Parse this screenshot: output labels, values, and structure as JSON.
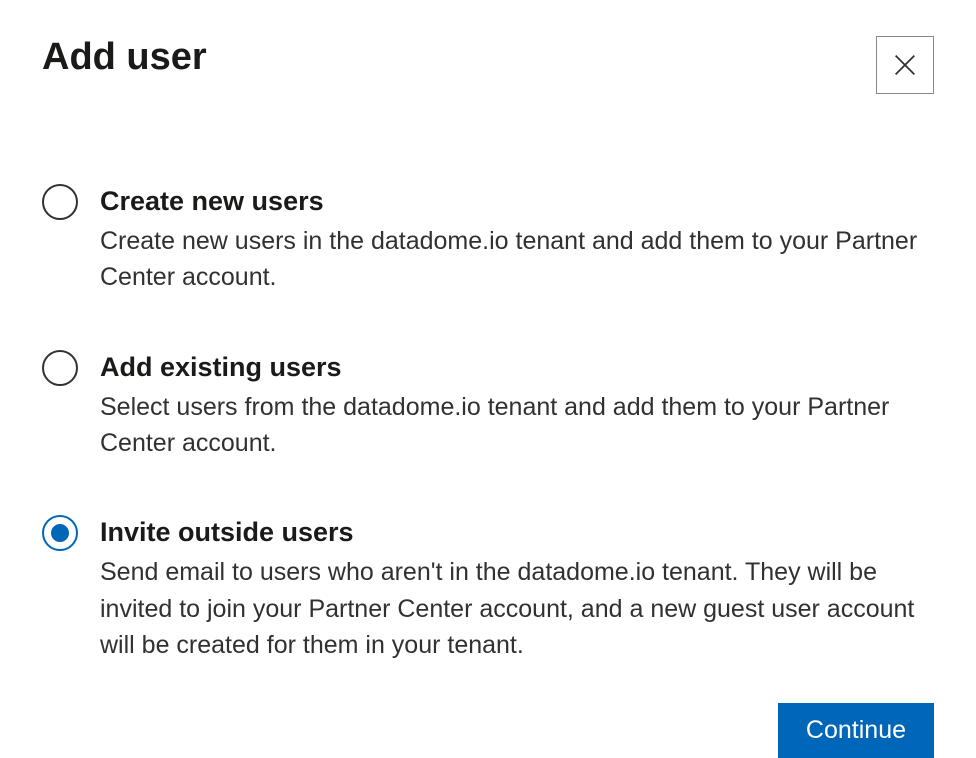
{
  "dialog": {
    "title": "Add user",
    "options": [
      {
        "title": "Create new users",
        "description": "Create new users in the datadome.io tenant and add them to your Partner Center account.",
        "selected": false
      },
      {
        "title": "Add existing users",
        "description": "Select users from the datadome.io tenant and add them to your Partner Center account.",
        "selected": false
      },
      {
        "title": "Invite outside users",
        "description": "Send email to users who aren't in the datadome.io tenant. They will be invited to join your Partner Center account, and a new guest user account will be created for them in your tenant.",
        "selected": true
      }
    ],
    "continue_label": "Continue"
  }
}
